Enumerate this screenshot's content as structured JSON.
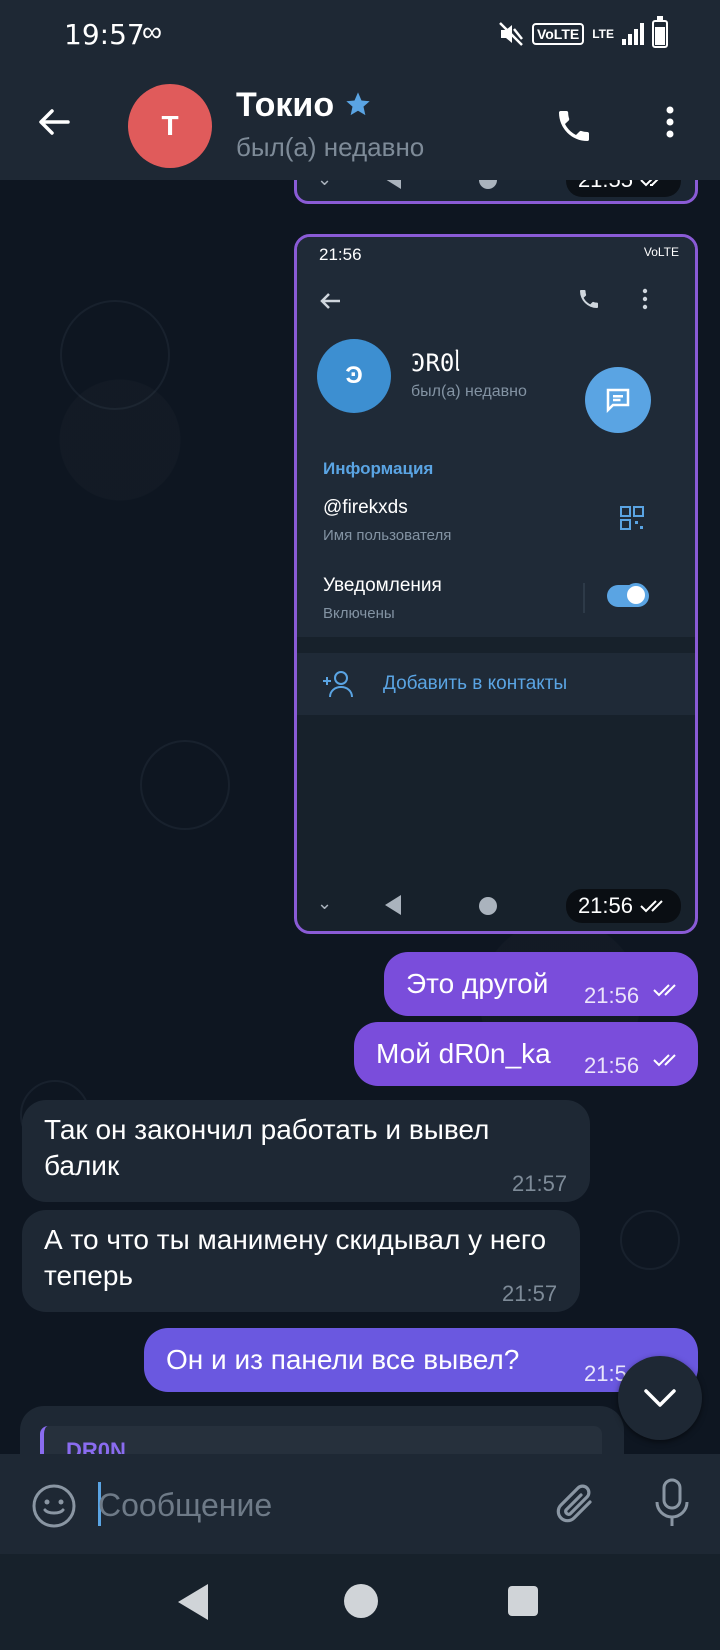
{
  "status_bar": {
    "time": "19:57",
    "infinity": "∞",
    "volte": "VoLTE",
    "lte": "LTE"
  },
  "header": {
    "avatar_letter": "T",
    "title": "Токио",
    "subtitle": "был(а) недавно"
  },
  "screenshot_top": {
    "time": "21:55"
  },
  "screenshot_main": {
    "status_time": "21:56",
    "status_right": "VoLTE",
    "avatar_letter": "Ͽ",
    "name": "ϿR0ᥣ",
    "status": "был(а) недавно",
    "info_title": "Информация",
    "username": "@firekxds",
    "username_label": "Имя пользователя",
    "notifications": "Уведомления",
    "notifications_value": "Включены",
    "add_contact": "Добавить в контакты",
    "time": "21:56"
  },
  "messages": [
    {
      "text": "Это другой",
      "time": "21:56",
      "dir": "out"
    },
    {
      "text": "Мой dR0n_ka",
      "time": "21:56",
      "dir": "out"
    },
    {
      "text": "Так он закончил работать и вывел балик",
      "time": "21:57",
      "dir": "in"
    },
    {
      "text": "А то что ты манимену скидывал у него теперь",
      "time": "21:57",
      "dir": "in"
    },
    {
      "text": "Он и из панели все вывел?",
      "time": "21:5",
      "dir": "out"
    }
  ],
  "reply": {
    "name": "DR0N"
  },
  "input": {
    "placeholder": "Сообщение"
  },
  "colors": {
    "header": "#1e2834",
    "background": "#0e1621",
    "outgoing": "#7a4ddb",
    "incoming": "#1e2834",
    "accent": "#5aa4e3"
  }
}
